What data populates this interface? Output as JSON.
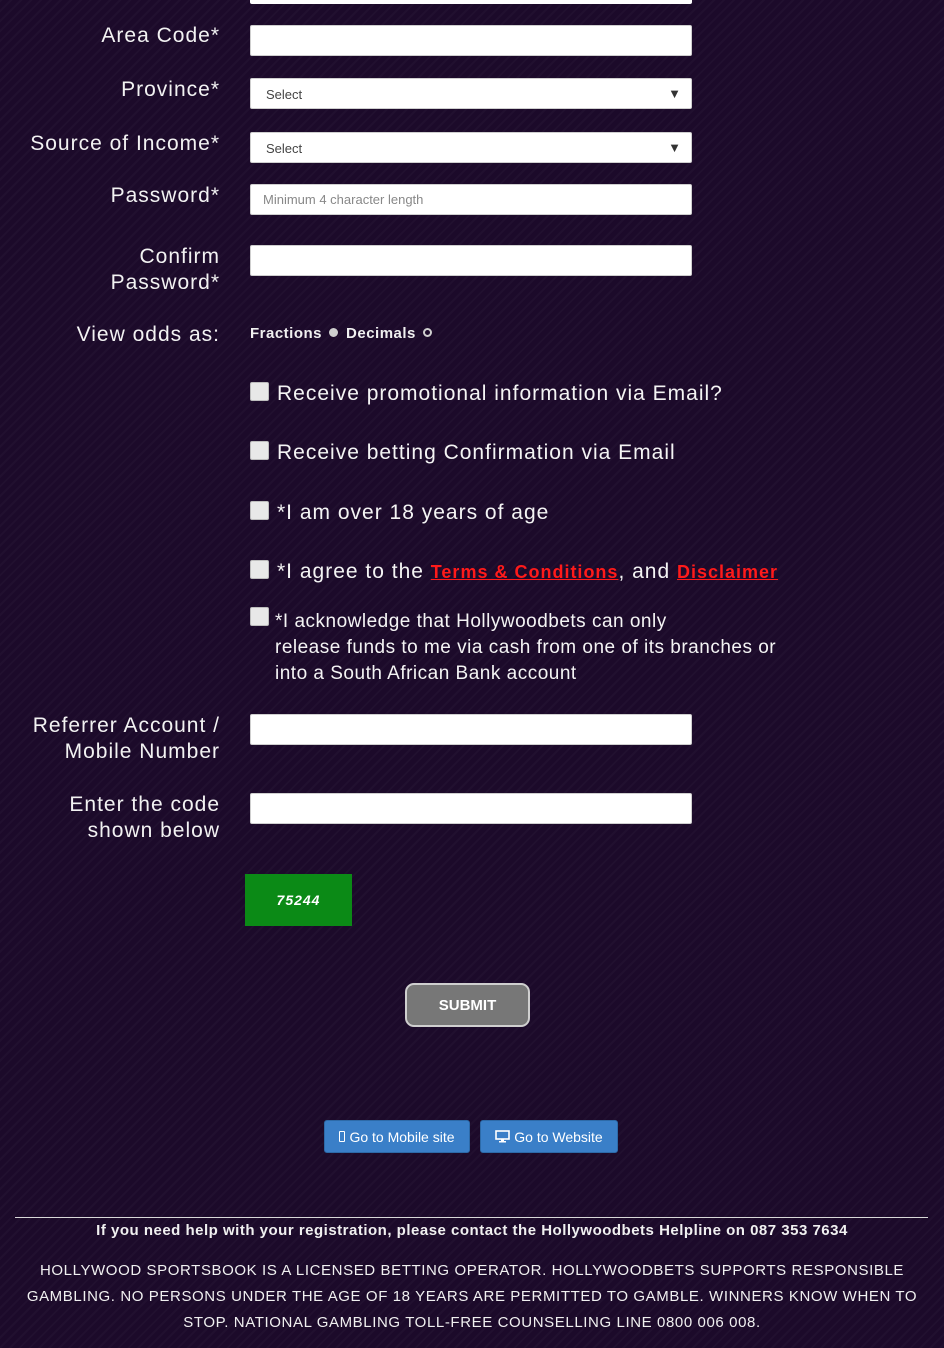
{
  "form": {
    "area_code_label": "Area Code*",
    "province_label": "Province*",
    "province_value": "Select",
    "income_label": "Source of Income*",
    "income_value": "Select",
    "password_label": "Password*",
    "password_placeholder": "Minimum 4 character length",
    "confirm_label_1": "Confirm",
    "confirm_label_2": "Password*",
    "odds_label": "View odds as:",
    "odds_fractions": "Fractions",
    "odds_decimals": "Decimals",
    "odds_selected": "Fractions",
    "cb_promo": "Receive promotional information via Email?",
    "cb_betting": "Receive betting Confirmation via Email",
    "cb_age": "*I am over 18 years of age",
    "cb_agree_prefix": "*I agree to the ",
    "cb_agree_terms": "Terms & Conditions",
    "cb_agree_mid": ", and ",
    "cb_agree_disclaimer": "Disclaimer",
    "cb_ack_1": "*I acknowledge that Hollywoodbets can only",
    "cb_ack_2": "release funds to me via cash from one of its branches or",
    "cb_ack_3": "into a South African Bank account",
    "referrer_label_1": "Referrer Account /",
    "referrer_label_2": "Mobile Number",
    "code_label_1": "Enter the code",
    "code_label_2": "shown below",
    "captcha_value": "75244",
    "submit_label": "SUBMIT"
  },
  "nav": {
    "mobile_label": "Go to Mobile site",
    "website_label": "Go to Website"
  },
  "footer": {
    "help": "If you need help with your registration, please contact the Hollywoodbets Helpline on 087 353 7634",
    "legal": "HOLLYWOOD SPORTSBOOK IS A LICENSED BETTING OPERATOR. HOLLYWOODBETS SUPPORTS RESPONSIBLE GAMBLING. NO PERSONS UNDER THE AGE OF 18 YEARS ARE PERMITTED TO GAMBLE. WINNERS KNOW WHEN TO STOP. NATIONAL GAMBLING TOLL-FREE COUNSELLING LINE 0800 006 008."
  },
  "colors": {
    "background": "#1c0a2a",
    "link_red": "#ff1a1a",
    "captcha_green": "#0b8a16",
    "nav_blue": "#3a7fc8",
    "submit_gray": "#777777"
  },
  "icons": [
    "mobile-icon",
    "desktop-icon",
    "dropdown-arrow-icon"
  ]
}
